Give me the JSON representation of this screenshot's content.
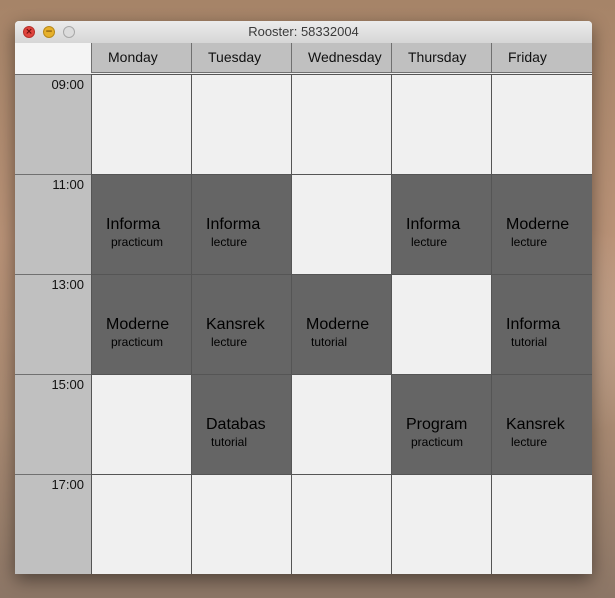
{
  "window": {
    "title": "Rooster: 58332004"
  },
  "days": [
    "Monday",
    "Tuesday",
    "Wednesday",
    "Thursday",
    "Friday"
  ],
  "times": [
    "09:00",
    "11:00",
    "13:00",
    "15:00",
    "17:00"
  ],
  "schedule": [
    [
      "",
      "",
      "",
      "",
      ""
    ],
    [
      [
        "Informa",
        "practicum"
      ],
      [
        "Informa",
        "lecture"
      ],
      "",
      [
        "Informa",
        "lecture"
      ],
      [
        "Moderne",
        "lecture"
      ]
    ],
    [
      [
        "Moderne",
        "practicum"
      ],
      [
        "Kansrek",
        "lecture"
      ],
      [
        "Moderne",
        "tutorial"
      ],
      "",
      [
        "Informa",
        "tutorial"
      ]
    ],
    [
      "",
      [
        "Databas",
        "tutorial"
      ],
      "",
      [
        "Program",
        "practicum"
      ],
      [
        "Kansrek",
        "lecture"
      ]
    ],
    [
      "",
      "",
      "",
      "",
      ""
    ]
  ]
}
